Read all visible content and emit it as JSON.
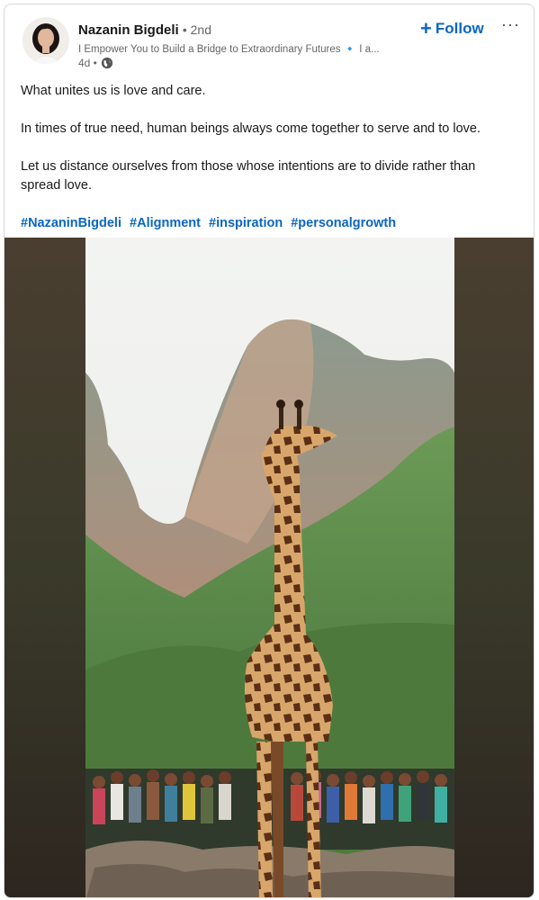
{
  "author": {
    "name": "Nazanin Bigdeli",
    "degree": "• 2nd",
    "headline": "I Empower You to Build a Bridge to Extraordinary Futures",
    "headline_sep": "🔹",
    "headline_more": "I a...",
    "time": "4d •"
  },
  "actions": {
    "follow_label": "Follow",
    "follow_icon": "+",
    "more_label": "···"
  },
  "post": {
    "paragraphs": [
      "What unites us is love and care.",
      "In times of true need, human beings always come together to serve and to love.",
      "Let us distance ourselves from those whose intentions are to divide rather than spread love."
    ],
    "hashtags": [
      "#NazaninBigdeli",
      "#Alignment",
      "#inspiration",
      "#personalgrowth"
    ]
  },
  "icons": {
    "globe": "globe-icon",
    "avatar": "avatar",
    "more": "more-options-icon"
  },
  "colors": {
    "link": "#0a66c2",
    "muted": "#666666",
    "border": "#d7d7d7"
  }
}
